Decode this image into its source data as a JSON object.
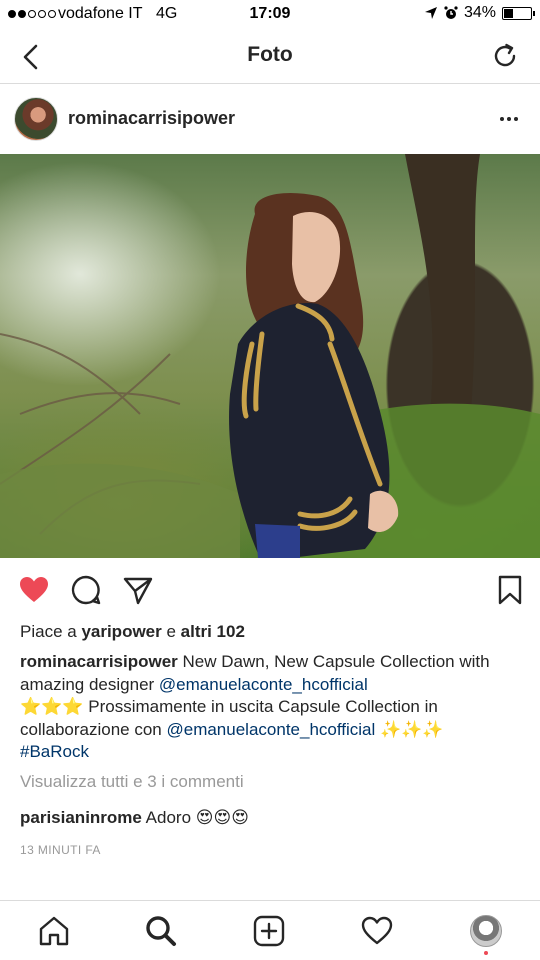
{
  "status_bar": {
    "carrier": "vodafone IT",
    "network": "4G",
    "time": "17:09",
    "battery_text": "34%",
    "battery_level": 0.34
  },
  "nav": {
    "title": "Foto"
  },
  "post": {
    "username": "rominacarrisipower",
    "likes": {
      "prefix": "Piace a ",
      "liker": "yaripower",
      "joiner": " e ",
      "others": "altri 102"
    },
    "caption": {
      "user": "rominacarrisipower",
      "text1": " New Dawn, New Capsule Collection with amazing designer ",
      "mention1": "@emanuelaconte_hcofficial",
      "stars": " ⭐⭐⭐ ",
      "text2": "Prossimamente in uscita Capsule Collection in collaborazione con ",
      "mention2": "@emanuelaconte_hcofficial",
      "sparkles": " ✨✨✨ ",
      "hashtag": "#BaRock"
    },
    "view_comments": "Visualizza tutti e 3 i commenti",
    "comment": {
      "user": "parisianinrome",
      "text": " Adoro 😍😍😍"
    },
    "timestamp": "13 MINUTI FA"
  },
  "colors": {
    "like_red": "#ed4956",
    "link_blue": "#003569",
    "muted_gray": "#999999",
    "divider": "#dbdbdb"
  },
  "icons": {
    "back": "chevron-left-icon",
    "refresh": "refresh-icon",
    "more": "more-horizontal-icon",
    "like": "heart-filled-icon",
    "comment": "comment-icon",
    "share": "paper-plane-icon",
    "save": "bookmark-icon",
    "home": "home-icon",
    "search": "search-icon",
    "add": "plus-square-icon",
    "activity": "heart-outline-icon",
    "profile": "profile-avatar"
  }
}
